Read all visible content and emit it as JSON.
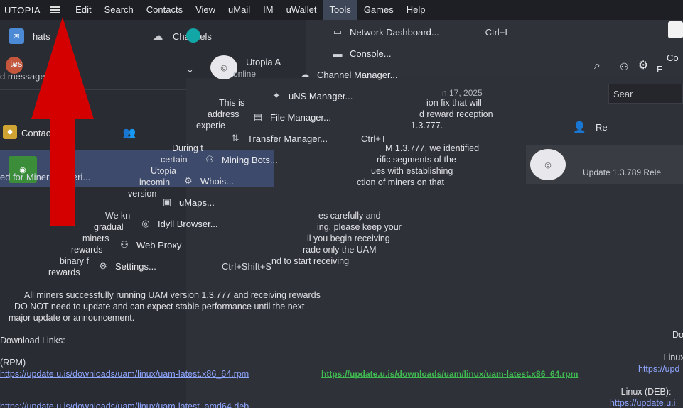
{
  "menubar": {
    "app_title": "UTOPIA",
    "items": [
      "Edit",
      "Search",
      "Contacts",
      "View",
      "uMail",
      "IM",
      "uWallet",
      "Tools",
      "Games",
      "Help"
    ]
  },
  "left": {
    "chats_label": "hats",
    "chat_name": "tes",
    "chat_preview": "d message",
    "contacts_label": "Contacts",
    "channel_row_label": "ed for Miners Experi...",
    "channels_label": "Channels"
  },
  "center": {
    "channel_name": "Utopia A",
    "online_label": "online",
    "date_label": "n 17, 2025",
    "message_lines": [
      "This is",
      "address",
      "experie",
      "During t",
      "certain",
      "Utopia",
      "incomin",
      "version",
      "We kn",
      "gradual",
      "miners",
      "rewards",
      "binary f",
      "rewards"
    ],
    "message_lines_right": [
      "ion fix that will",
      "d reward reception",
      "1.3.777.",
      "M 1.3.777, we identified",
      "rific segments of the",
      "ues with establishing",
      "ction of miners on that",
      "es carefully and",
      "ing, please keep your",
      "il you begin receiving",
      "rade only the UAM",
      "nd to start receiving"
    ],
    "body_lines": [
      "All miners successfully running UAM version 1.3.777 and receiving rewards",
      "DO NOT need to update and can expect stable performance until the next",
      "major update or announcement."
    ],
    "download_label": "Download Links:",
    "rpm_label": "(RPM)",
    "rpm_link": "https://update.u.is/downloads/uam/linux/uam-latest.x86_64.rpm",
    "green_link": "https://update.u.is/downloads/uam/linux/uam-latest.x86_64.rpm",
    "deb_link": "https://update.u.is/downloads/uam/linux/uam-latest_amd64.deb"
  },
  "right": {
    "search_placeholder": "Sear",
    "e_label": "E",
    "co_label": "Co",
    "re_label": "Re",
    "bot_card_text": "Update 1.3.789 Rele",
    "linux_label": "- Linux",
    "linux_link": "https://upd",
    "linux_deb_label": "- Linux (DEB):",
    "linux_deb_link": "https://update.u.i",
    "dl_label": "Dow"
  },
  "dropdown": {
    "items": [
      {
        "label": "Network Dashboard...",
        "shortcut": "Ctrl+I",
        "icon": "monitor-icon"
      },
      {
        "label": "Console...",
        "shortcut": "",
        "icon": "terminal-icon"
      },
      {
        "label": "Channel Manager...",
        "shortcut": "",
        "icon": "channel-icon"
      },
      {
        "label": "uNS Manager...",
        "shortcut": "",
        "icon": "uns-icon"
      },
      {
        "label": "File Manager...",
        "shortcut": "",
        "icon": "folder-icon"
      },
      {
        "label": "Transfer Manager...",
        "shortcut": "Ctrl+T",
        "icon": "transfer-icon"
      },
      {
        "label": "Mining Bots...",
        "shortcut": "",
        "icon": "bot-icon"
      },
      {
        "label": "Whois...",
        "shortcut": "",
        "icon": "gear-icon"
      },
      {
        "label": "uMaps...",
        "shortcut": "",
        "icon": "map-icon"
      },
      {
        "label": "Idyll Browser...",
        "shortcut": "",
        "icon": "compass-icon"
      },
      {
        "label": "Web Proxy",
        "shortcut": "",
        "icon": "proxy-icon"
      },
      {
        "label": "Settings...",
        "shortcut": "Ctrl+Shift+S",
        "icon": "settings-icon"
      }
    ]
  },
  "colors": {
    "menubar_bg": "#1e1f25",
    "active_menu": "#3d4758",
    "accent_red": "#d40000",
    "link_green": "#3fb950",
    "channel_row": "#3d4a6b"
  }
}
